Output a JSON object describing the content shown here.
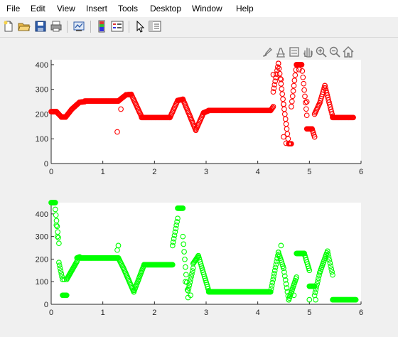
{
  "menu": [
    "File",
    "Edit",
    "View",
    "Insert",
    "Tools",
    "Desktop",
    "Window",
    "Help"
  ],
  "toolbar_icons": [
    "new-figure-icon",
    "open-file-icon",
    "save-icon",
    "print-icon",
    "link-plot-icon",
    "insert-colorbar-icon",
    "insert-legend-icon",
    "edit-plot-icon",
    "property-inspector-icon"
  ],
  "axes_toolbar_icons": [
    "brush-icon",
    "data-tips-icon",
    "rotate-icon",
    "pan-icon",
    "zoom-in-icon",
    "zoom-out-icon",
    "home-icon"
  ],
  "colors": {
    "top": "#ff0000",
    "bottom": "#00ff00"
  },
  "chart_data": [
    {
      "type": "scatter",
      "marker": "open-circle",
      "color": "#ff0000",
      "xlim": [
        0,
        6
      ],
      "ylim": [
        0,
        420
      ],
      "xticks": [
        "0",
        "1",
        "2",
        "3",
        "4",
        "5",
        "6"
      ],
      "yticks": [
        "0",
        "100",
        "200",
        "300",
        "400"
      ],
      "grid": false,
      "segments": [
        {
          "x": [
            0.0,
            0.1
          ],
          "y": [
            210,
            210
          ]
        },
        {
          "x": [
            0.1,
            0.2
          ],
          "y": [
            210,
            188
          ]
        },
        {
          "x": [
            0.2,
            0.28
          ],
          "y": [
            188,
            188
          ]
        },
        {
          "x": [
            0.28,
            0.4
          ],
          "y": [
            188,
            220
          ]
        },
        {
          "x": [
            0.4,
            0.55
          ],
          "y": [
            220,
            248
          ]
        },
        {
          "x": [
            0.55,
            0.65
          ],
          "y": [
            248,
            250
          ]
        },
        {
          "x": [
            0.65,
            1.3
          ],
          "y": [
            253,
            253
          ]
        },
        {
          "x": [
            1.3,
            1.45
          ],
          "y": [
            253,
            278
          ]
        },
        {
          "x": [
            1.45,
            1.55
          ],
          "y": [
            278,
            280
          ]
        },
        {
          "x": [
            1.55,
            1.75
          ],
          "y": [
            280,
            190
          ]
        },
        {
          "x": [
            1.75,
            2.3
          ],
          "y": [
            186,
            186
          ]
        },
        {
          "x": [
            2.3,
            2.45
          ],
          "y": [
            186,
            255
          ]
        },
        {
          "x": [
            2.45,
            2.55
          ],
          "y": [
            255,
            260
          ]
        },
        {
          "x": [
            2.55,
            2.8
          ],
          "y": [
            260,
            135
          ]
        },
        {
          "x": [
            2.8,
            2.95
          ],
          "y": [
            135,
            205
          ]
        },
        {
          "x": [
            2.95,
            3.05
          ],
          "y": [
            205,
            214
          ]
        },
        {
          "x": [
            3.05,
            4.25
          ],
          "y": [
            215,
            215
          ]
        },
        {
          "x": [
            4.25,
            4.3
          ],
          "y": [
            215,
            230
          ]
        },
        {
          "x": [
            4.3,
            4.4
          ],
          "y": [
            290,
            405
          ]
        },
        {
          "x": [
            4.4,
            4.5
          ],
          "y": [
            405,
            240
          ]
        },
        {
          "x": [
            4.5,
            4.6
          ],
          "y": [
            240,
            80
          ]
        },
        {
          "x": [
            4.6,
            4.65
          ],
          "y": [
            80,
            80
          ]
        },
        {
          "x": [
            4.65,
            4.75
          ],
          "y": [
            230,
            400
          ]
        },
        {
          "x": [
            4.75,
            4.85
          ],
          "y": [
            400,
            400
          ]
        },
        {
          "x": [
            4.85,
            4.95
          ],
          "y": [
            400,
            195
          ]
        },
        {
          "x": [
            4.95,
            5.05
          ],
          "y": [
            140,
            140
          ]
        },
        {
          "x": [
            5.05,
            5.1
          ],
          "y": [
            140,
            108
          ]
        },
        {
          "x": [
            5.1,
            5.2
          ],
          "y": [
            200,
            245
          ]
        },
        {
          "x": [
            5.2,
            5.3
          ],
          "y": [
            245,
            315
          ]
        },
        {
          "x": [
            5.3,
            5.45
          ],
          "y": [
            315,
            190
          ]
        },
        {
          "x": [
            5.45,
            5.85
          ],
          "y": [
            186,
            186
          ]
        }
      ],
      "extra_points": [
        [
          1.28,
          128
        ],
        [
          1.35,
          220
        ],
        [
          4.5,
          108
        ],
        [
          4.55,
          82
        ],
        [
          5.1,
          108
        ],
        [
          4.3,
          360
        ],
        [
          4.45,
          340
        ],
        [
          4.8,
          380
        ],
        [
          4.95,
          250
        ]
      ]
    },
    {
      "type": "scatter",
      "marker": "open-circle",
      "color": "#00ff00",
      "xlim": [
        0,
        6
      ],
      "ylim": [
        0,
        450
      ],
      "xticks": [
        "0",
        "1",
        "2",
        "3",
        "4",
        "5",
        "6"
      ],
      "yticks": [
        "0",
        "100",
        "200",
        "300",
        "400"
      ],
      "grid": false,
      "segments": [
        {
          "x": [
            0.0,
            0.08
          ],
          "y": [
            450,
            450
          ]
        },
        {
          "x": [
            0.08,
            0.15
          ],
          "y": [
            420,
            270
          ]
        },
        {
          "x": [
            0.15,
            0.22
          ],
          "y": [
            185,
            110
          ]
        },
        {
          "x": [
            0.22,
            0.3
          ],
          "y": [
            40,
            40
          ]
        },
        {
          "x": [
            0.3,
            0.5
          ],
          "y": [
            110,
            190
          ]
        },
        {
          "x": [
            0.5,
            0.55
          ],
          "y": [
            205,
            210
          ]
        },
        {
          "x": [
            0.55,
            1.3
          ],
          "y": [
            205,
            205
          ]
        },
        {
          "x": [
            1.3,
            1.4
          ],
          "y": [
            205,
            160
          ]
        },
        {
          "x": [
            1.4,
            1.6
          ],
          "y": [
            160,
            55
          ]
        },
        {
          "x": [
            1.6,
            1.8
          ],
          "y": [
            55,
            175
          ]
        },
        {
          "x": [
            1.8,
            2.35
          ],
          "y": [
            175,
            175
          ]
        },
        {
          "x": [
            2.35,
            2.45
          ],
          "y": [
            260,
            380
          ]
        },
        {
          "x": [
            2.45,
            2.55
          ],
          "y": [
            425,
            425
          ]
        },
        {
          "x": [
            2.55,
            2.65
          ],
          "y": [
            300,
            30
          ]
        },
        {
          "x": [
            2.65,
            2.75
          ],
          "y": [
            60,
            160
          ]
        },
        {
          "x": [
            2.75,
            2.85
          ],
          "y": [
            180,
            215
          ]
        },
        {
          "x": [
            2.85,
            3.05
          ],
          "y": [
            215,
            60
          ]
        },
        {
          "x": [
            3.05,
            4.25
          ],
          "y": [
            55,
            55
          ]
        },
        {
          "x": [
            4.25,
            4.4
          ],
          "y": [
            55,
            230
          ]
        },
        {
          "x": [
            4.4,
            4.5
          ],
          "y": [
            230,
            160
          ]
        },
        {
          "x": [
            4.5,
            4.6
          ],
          "y": [
            160,
            20
          ]
        },
        {
          "x": [
            4.6,
            4.75
          ],
          "y": [
            20,
            120
          ]
        },
        {
          "x": [
            4.75,
            4.9
          ],
          "y": [
            225,
            225
          ]
        },
        {
          "x": [
            4.9,
            5.0
          ],
          "y": [
            225,
            150
          ]
        },
        {
          "x": [
            5.0,
            5.1
          ],
          "y": [
            80,
            80
          ]
        },
        {
          "x": [
            5.1,
            5.2
          ],
          "y": [
            40,
            140
          ]
        },
        {
          "x": [
            5.2,
            5.35
          ],
          "y": [
            140,
            235
          ]
        },
        {
          "x": [
            5.35,
            5.45
          ],
          "y": [
            235,
            130
          ]
        },
        {
          "x": [
            5.45,
            5.9
          ],
          "y": [
            20,
            20
          ]
        }
      ],
      "extra_points": [
        [
          0.1,
          350
        ],
        [
          0.12,
          300
        ],
        [
          0.25,
          110
        ],
        [
          1.28,
          240
        ],
        [
          1.3,
          260
        ],
        [
          2.6,
          100
        ],
        [
          2.7,
          40
        ],
        [
          4.45,
          260
        ],
        [
          4.7,
          40
        ],
        [
          5.0,
          20
        ],
        [
          5.12,
          20
        ]
      ]
    }
  ]
}
